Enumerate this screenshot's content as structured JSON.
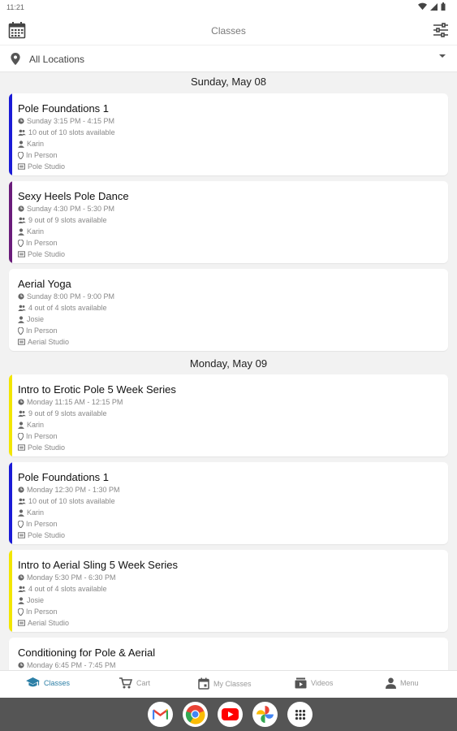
{
  "status_bar": {
    "time": "11:21"
  },
  "app_bar": {
    "title": "Classes"
  },
  "location_filter": {
    "value": "All Locations"
  },
  "sections": [
    {
      "date": "Sunday, May 08"
    },
    {
      "date": "Monday, May 09"
    }
  ],
  "classes": [
    {
      "title": "Pole Foundations 1",
      "time": "Sunday 3:15 PM - 4:15 PM",
      "slots": "10 out of 10 slots available",
      "instructor": "Karin",
      "mode": "In Person",
      "room": "Pole Studio",
      "accent": "#1a1ad6"
    },
    {
      "title": "Sexy Heels Pole Dance",
      "time": "Sunday 4:30 PM - 5:30 PM",
      "slots": "9 out of 9 slots available",
      "instructor": "Karin",
      "mode": "In Person",
      "room": "Pole Studio",
      "accent": "#6a1b7a"
    },
    {
      "title": "Aerial Yoga",
      "time": "Sunday 8:00 PM - 9:00 PM",
      "slots": "4 out of 4 slots available",
      "instructor": "Josie",
      "mode": "In Person",
      "room": "Aerial Studio",
      "accent": ""
    },
    {
      "title": "Intro to Erotic Pole 5 Week Series",
      "time": "Monday 11:15 AM - 12:15 PM",
      "slots": "9 out of 9 slots available",
      "instructor": "Karin",
      "mode": "In Person",
      "room": "Pole Studio",
      "accent": "#f2e600"
    },
    {
      "title": "Pole Foundations 1",
      "time": "Monday 12:30 PM - 1:30 PM",
      "slots": "10 out of 10 slots available",
      "instructor": "Karin",
      "mode": "In Person",
      "room": "Pole Studio",
      "accent": "#1a1ad6"
    },
    {
      "title": "Intro to Aerial Sling 5 Week Series",
      "time": "Monday 5:30 PM - 6:30 PM",
      "slots": "4 out of 4 slots available",
      "instructor": "Josie",
      "mode": "In Person",
      "room": "Aerial Studio",
      "accent": "#f2e600"
    },
    {
      "title": "Conditioning for Pole & Aerial",
      "time": "Monday 6:45 PM - 7:45 PM",
      "slots": "",
      "instructor": "",
      "mode": "",
      "room": "",
      "accent": ""
    }
  ],
  "bottom_nav": {
    "classes": "Classes",
    "cart": "Cart",
    "my_classes": "My Classes",
    "videos": "Videos",
    "menu": "Menu",
    "active_color": "#2c7fa6"
  },
  "dock": [
    "gmail-icon",
    "chrome-icon",
    "youtube-icon",
    "photos-icon",
    "app-drawer-icon"
  ]
}
